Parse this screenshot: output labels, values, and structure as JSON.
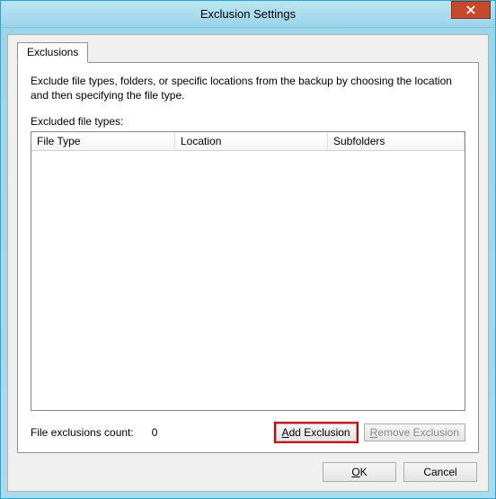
{
  "window": {
    "title": "Exclusion Settings"
  },
  "tab": {
    "label": "Exclusions"
  },
  "panel": {
    "description": "Exclude file types, folders, or specific locations from the backup by choosing the location and then specifying the file type.",
    "list_label": "Excluded file types:",
    "columns": {
      "file_type": "File Type",
      "location": "Location",
      "subfolders": "Subfolders"
    },
    "rows": []
  },
  "footer": {
    "count_label": "File exclusions count:",
    "count_value": "0",
    "add_label": "Add Exclusion",
    "remove_label": "Remove Exclusion"
  },
  "buttons": {
    "ok_prefix": "O",
    "ok_rest": "K",
    "cancel": "Cancel"
  }
}
